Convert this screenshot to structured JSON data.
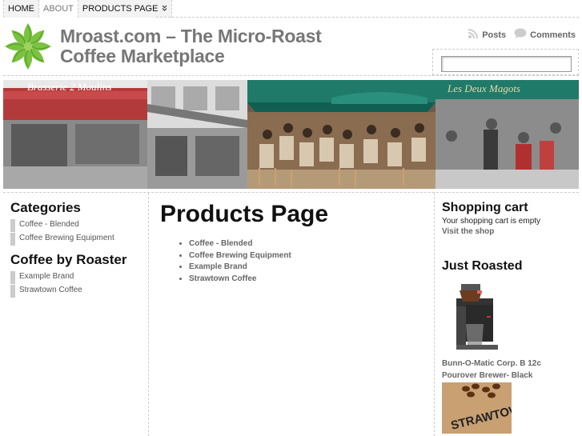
{
  "nav": {
    "items": [
      {
        "label": "HOME"
      },
      {
        "label": "ABOUT"
      },
      {
        "label": "PRODUCTS PAGE",
        "chevron": "»"
      }
    ]
  },
  "site": {
    "title_line1": "Mroast.com – The Micro-Roast",
    "title_line2": "Coffee Marketplace",
    "logo_icon": "green-leaf-star-logo"
  },
  "feeds": {
    "posts_label": "Posts",
    "comments_label": "Comments"
  },
  "search": {
    "value": ""
  },
  "banner": {
    "signs": [
      "Brasserie 2 Moulins",
      "Les Deux Magots"
    ]
  },
  "sidebar_left": {
    "categories_title": "Categories",
    "categories": [
      "Coffee - Blended",
      "Coffee Brewing Equipment"
    ],
    "roaster_title": "Coffee by Roaster",
    "roasters": [
      "Example Brand",
      "Strawtown Coffee"
    ]
  },
  "main": {
    "title": "Products Page",
    "links": [
      "Coffee - Blended",
      "Coffee Brewing Equipment",
      "Example Brand",
      "Strawtown Coffee"
    ]
  },
  "sidebar_right": {
    "cart_title": "Shopping cart",
    "cart_status": "Your shopping cart is empty",
    "visit_shop": "Visit the shop",
    "just_roasted_title": "Just Roasted",
    "product1_name": "Bunn-O-Matic Corp. B 12c Pourover Brewer- Black",
    "product2_label": "STRAWTOWN"
  },
  "colors": {
    "accent_green": "#7cc242",
    "text_gray": "#777777",
    "rule": "#cccccc"
  }
}
